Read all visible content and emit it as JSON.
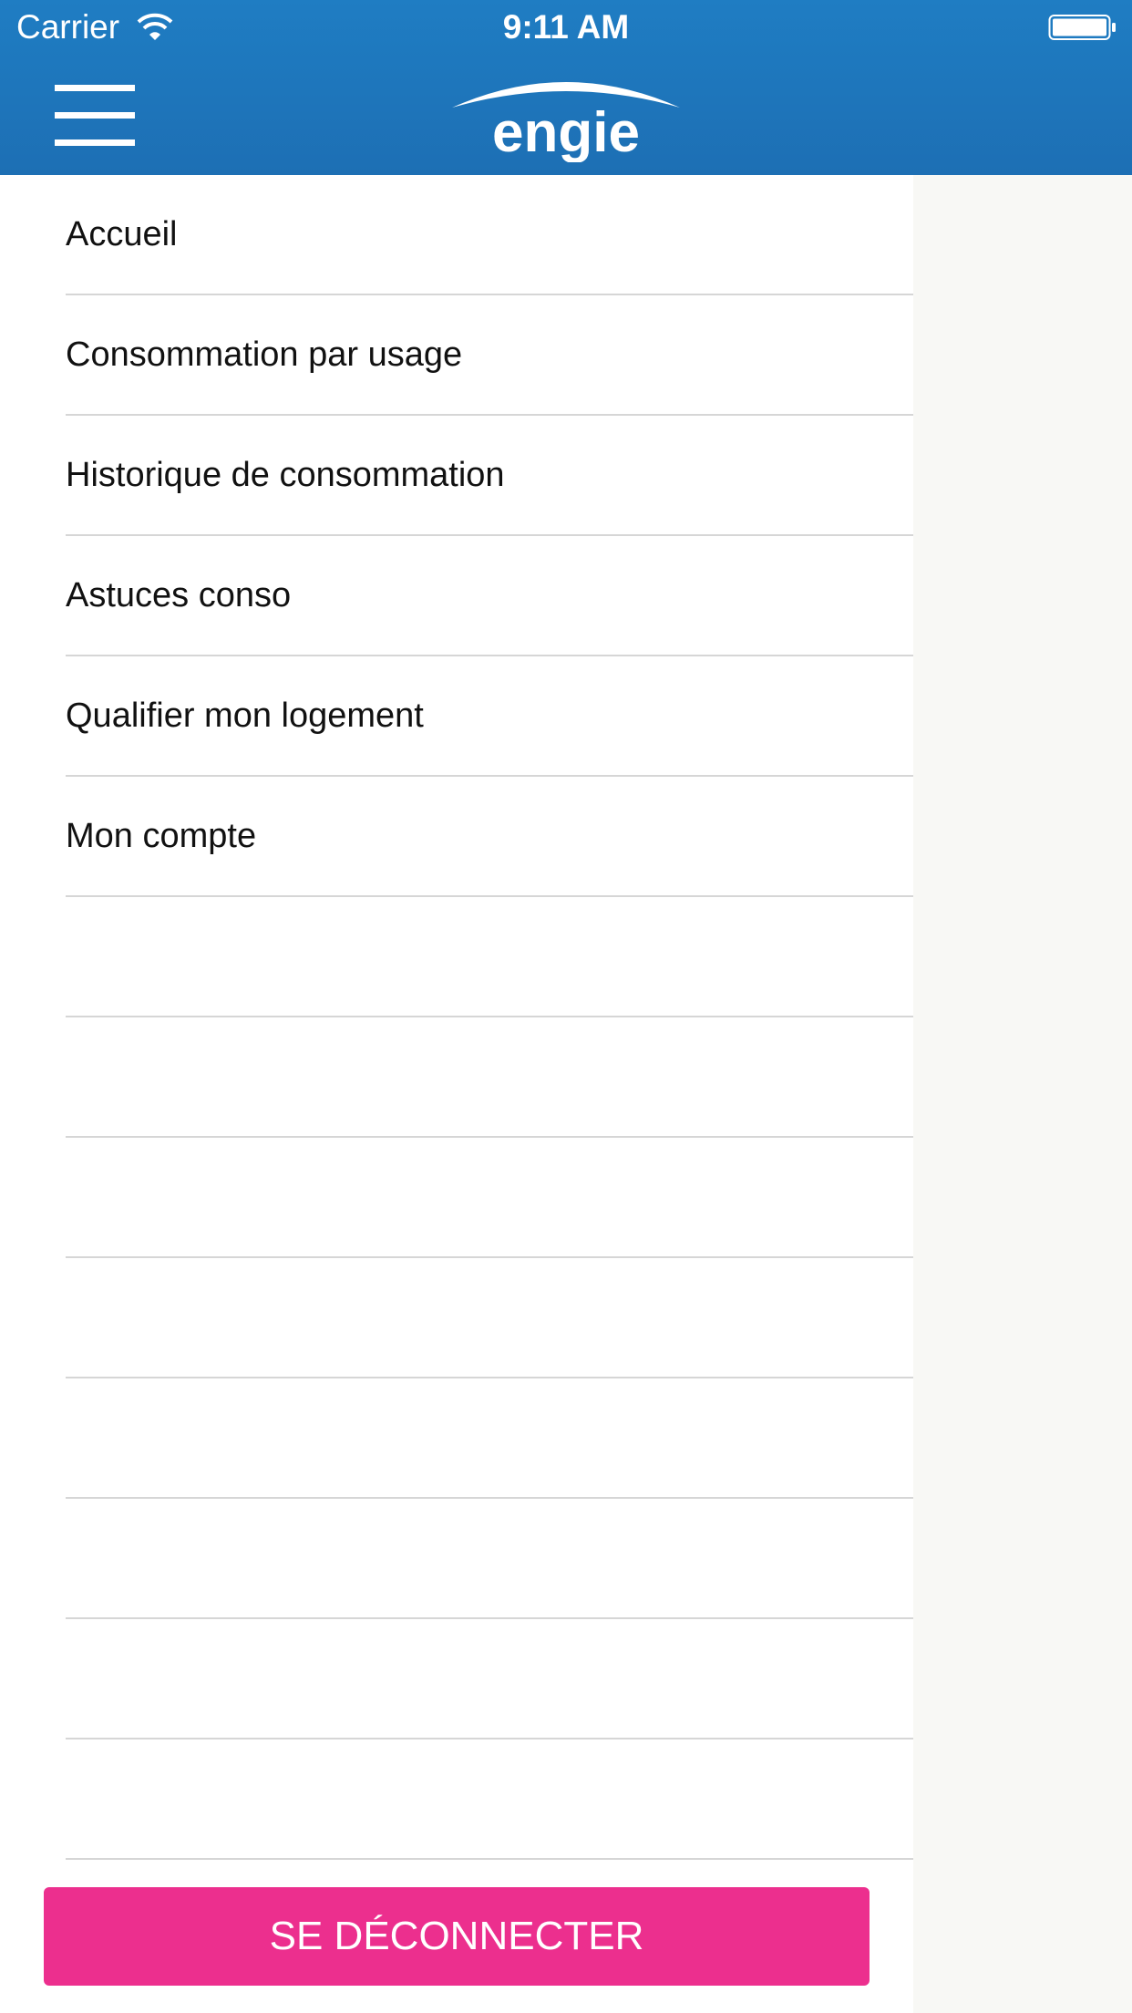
{
  "status_bar": {
    "carrier": "Carrier",
    "time": "9:11 AM",
    "wifi_icon": "wifi-icon",
    "battery_icon": "battery-icon"
  },
  "header": {
    "background_color": "#1f77bf",
    "menu_icon": "hamburger-menu-icon",
    "logo_text": "engie"
  },
  "menu": {
    "items": [
      {
        "label": "Accueil"
      },
      {
        "label": "Consommation par usage"
      },
      {
        "label": "Historique de consommation"
      },
      {
        "label": "Astuces conso"
      },
      {
        "label": "Qualifier mon logement"
      },
      {
        "label": "Mon compte"
      }
    ]
  },
  "logout": {
    "label": "SE DÉCONNECTER",
    "color": "#ec2f8e"
  }
}
